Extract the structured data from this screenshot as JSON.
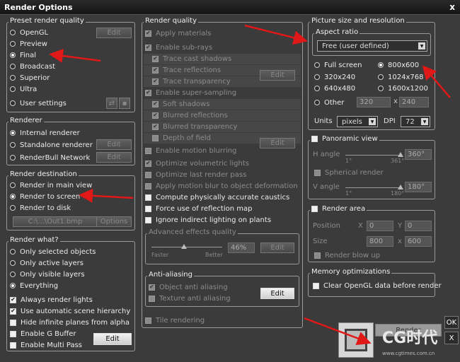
{
  "window": {
    "title": "Render Options",
    "close": "x"
  },
  "preset": {
    "title": "Preset render quality",
    "items": [
      "OpenGL",
      "Preview",
      "Final",
      "Broadcast",
      "Superior",
      "Ultra",
      "User settings"
    ],
    "selected": 2,
    "edit_label": "Edit"
  },
  "renderer": {
    "title": "Renderer",
    "items": [
      "Internal renderer",
      "Standalone renderer",
      "RenderBull Network"
    ],
    "selected": 0,
    "edit_label": "Edit"
  },
  "destination": {
    "title": "Render destination",
    "items": [
      "Render in main view",
      "Render to screen",
      "Render to disk"
    ],
    "selected": 1,
    "path": "C:\\...\\Out1.bmp",
    "options_label": "Options"
  },
  "render_what": {
    "title": "Render what?",
    "radios": [
      "Only selected objects",
      "Only active layers",
      "Only visible layers",
      "Everything"
    ],
    "selected": 3,
    "checks": [
      "Always render lights",
      "Use automatic scene hierarchy",
      "Hide infinite planes from alpha",
      "Enable G Buffer",
      "Enable Multi Pass"
    ],
    "edit_label": "Edit"
  },
  "quality": {
    "title": "Render quality",
    "items": [
      "Apply materials",
      "Enable sub-rays",
      "Trace cast shadows",
      "Trace reflections",
      "Trace transparency",
      "Enable super-sampling",
      "Soft shadows",
      "Blurred reflections",
      "Blurred transparency",
      "Depth of field",
      "Enable motion blurring",
      "Optimize volumetric lights",
      "Optimize last render pass",
      "Apply motion blur to object deformation",
      "Compute physically accurate caustics",
      "Force use of reflection map",
      "Ignore indirect lighting on plants"
    ],
    "edit_label": "Edit",
    "advanced_title": "Advanced effects quality",
    "faster": "Faster",
    "better": "Better",
    "percent": "46%",
    "advanced_level": 0.46
  },
  "antialiasing": {
    "title": "Anti-aliasing",
    "items": [
      "Object anti aliasing",
      "Texture anti aliasing"
    ],
    "edit_label": "Edit",
    "tile_rendering": "Tile rendering"
  },
  "picture": {
    "title": "Picture size and resolution",
    "aspect_title": "Aspect ratio",
    "aspect_value": "Free (user defined)",
    "sizes": [
      "Full screen",
      "800x600",
      "320x240",
      "1024x768",
      "640x480",
      "1600x1200"
    ],
    "other": "Other",
    "selected": "800x600",
    "width": "320",
    "height": "240",
    "times": "x",
    "units_label": "Units",
    "units_value": "pixels",
    "dpi_label": "DPI",
    "dpi_value": "72"
  },
  "panoramic": {
    "title": "Panoramic view",
    "h_angle": "H angle",
    "h_min": "1°",
    "h_max": "361°",
    "h_value": "360°",
    "spherical": "Spherical render",
    "v_angle": "V angle",
    "v_min": "1°",
    "v_max": "180°",
    "v_value": "180°"
  },
  "render_area": {
    "title": "Render area",
    "position": "Position",
    "size": "Size",
    "x": "X",
    "y": "Y",
    "x_val": "0",
    "y_val": "0",
    "w_val": "800",
    "h_val": "600",
    "times": "x",
    "blowup": "Render blow up"
  },
  "memory": {
    "title": "Memory optimizations",
    "clear": "Clear OpenGL data before render"
  },
  "bottom": {
    "render": "Render",
    "watermark": "CG时代",
    "watermark_url": "www.cgtimes.com.cn",
    "ok": "OK",
    "cancel": "X"
  },
  "colors": {
    "arrow": "#e01818",
    "background": "#3b3b3b",
    "border": "#9a9a9a"
  }
}
